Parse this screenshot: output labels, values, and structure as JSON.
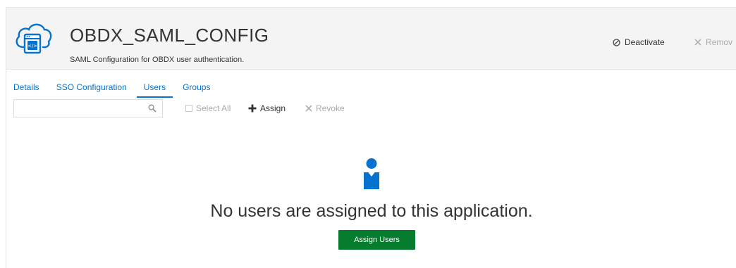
{
  "app": {
    "title": "OBDX_SAML_CONFIG",
    "description": "SAML Configuration for OBDX user authentication.",
    "icon": "cloud-app-icon"
  },
  "header_actions": {
    "deactivate_label": "Deactivate",
    "remove_label": "Remov"
  },
  "tabs": [
    {
      "label": "Details",
      "active": false
    },
    {
      "label": "SSO Configuration",
      "active": false
    },
    {
      "label": "Users",
      "active": true
    },
    {
      "label": "Groups",
      "active": false
    }
  ],
  "toolbar": {
    "search": {
      "value": "",
      "placeholder": ""
    },
    "select_all_label": "Select All",
    "assign_label": "Assign",
    "revoke_label": "Revoke"
  },
  "empty_state": {
    "message": "No users are assigned to this application.",
    "button_label": "Assign Users",
    "icon": "user-icon"
  },
  "colors": {
    "accent": "#0572ce",
    "button_green": "#067c2f",
    "header_bg": "#f4f4f4",
    "disabled_text": "#aaaaaa"
  }
}
